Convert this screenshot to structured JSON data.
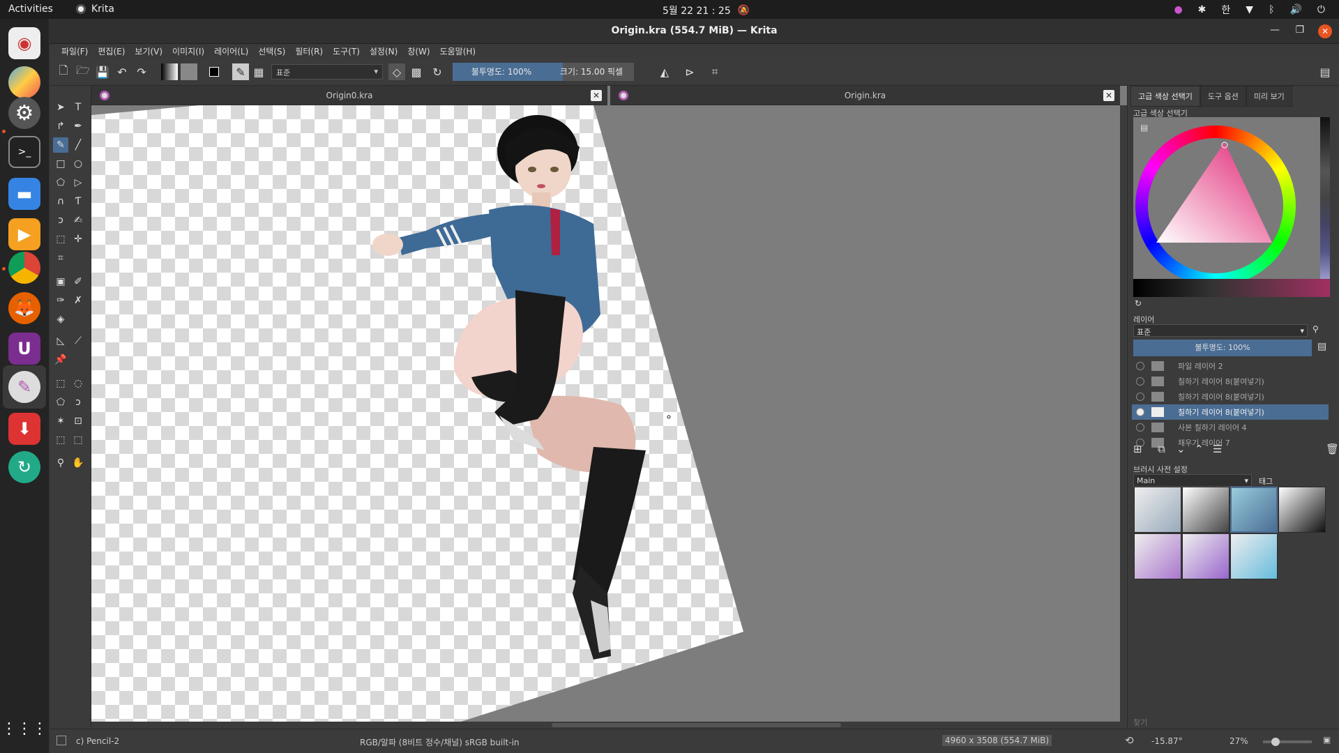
{
  "topbar": {
    "activities": "Activities",
    "app_name": "Krita",
    "clock": "5월 22  21 : 25",
    "tray_lang": "한"
  },
  "window": {
    "title": "Origin.kra (554.7 MiB)  — Krita"
  },
  "menu": {
    "items": [
      "파일(F)",
      "편집(E)",
      "보기(V)",
      "이미지(I)",
      "레이어(L)",
      "선택(S)",
      "필터(R)",
      "도구(T)",
      "설정(N)",
      "창(W)",
      "도움말(H)"
    ]
  },
  "toolbar": {
    "blend_mode": "표준",
    "opacity": "불투명도: 100%",
    "size": "크기: 15.00 픽셀"
  },
  "documents": {
    "tab1": "Origin0.kra",
    "tab2": "Origin.kra"
  },
  "right_panel": {
    "tabs": [
      "고급 색상 선택기",
      "도구 옵션",
      "미리 보기"
    ],
    "color_selector_title": "고급 색상 선택기",
    "layers_title": "레이어",
    "layers_blend": "표준",
    "layers_opacity": "불투명도:  100%",
    "layers": [
      {
        "name": "파일 레이어 2",
        "visible": false,
        "selected": false
      },
      {
        "name": "칠하기 레이어 8(붙여넣기)",
        "visible": false,
        "selected": false
      },
      {
        "name": "칠하기 레이어 8(붙여넣기)",
        "visible": false,
        "selected": false
      },
      {
        "name": "칠하기 레이어 8(붙여넣기)",
        "visible": true,
        "selected": true
      },
      {
        "name": "사본 칠하기 레이어 4",
        "visible": false,
        "selected": false
      },
      {
        "name": "채우기 레이어 7",
        "visible": false,
        "selected": false
      }
    ],
    "brush_presets_title": "브러시 사전 설정",
    "brush_tag": "Main",
    "brush_tag_btn": "태그",
    "search_placeholder": "찾기"
  },
  "status": {
    "brush": "c) Pencil-2",
    "color_space": "RGB/알파 (8비트 정수/채널)  sRGB built-in",
    "dimensions": "4960 x 3508 (554.7 MiB)",
    "rotation": "-15.87°",
    "zoom": "27%"
  },
  "colors": {
    "accent": "#4a6d94",
    "ubuntu_orange": "#e95420"
  }
}
